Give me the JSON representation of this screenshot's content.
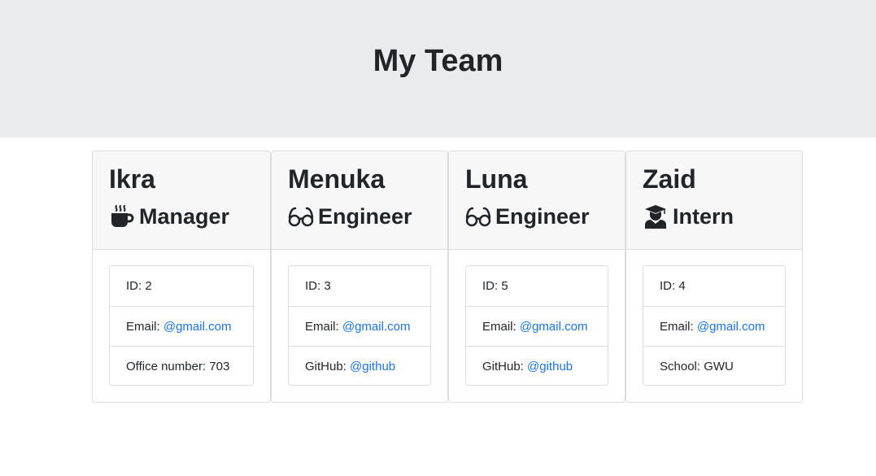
{
  "header": {
    "title": "My Team"
  },
  "team": [
    {
      "name": "Ikra",
      "role": "Manager",
      "role_icon": "coffee-mug-icon",
      "id_label": "ID:",
      "id": "2",
      "email_label": "Email:",
      "email": "@gmail.com",
      "extra_label": "Office number:",
      "extra_value": "703"
    },
    {
      "name": "Menuka",
      "role": "Engineer",
      "role_icon": "glasses-icon",
      "id_label": "ID:",
      "id": "3",
      "email_label": "Email:",
      "email": "@gmail.com",
      "extra_label": "GitHub:",
      "extra_value": "@github"
    },
    {
      "name": "Luna",
      "role": "Engineer",
      "role_icon": "glasses-icon",
      "id_label": "ID:",
      "id": "5",
      "email_label": "Email:",
      "email": "@gmail.com",
      "extra_label": "GitHub:",
      "extra_value": "@github"
    },
    {
      "name": "Zaid",
      "role": "Intern",
      "role_icon": "graduate-icon",
      "id_label": "ID:",
      "id": "4",
      "email_label": "Email:",
      "email": "@gmail.com",
      "extra_label": "School:",
      "extra_value": "GWU"
    }
  ],
  "colors": {
    "header_bg": "#e9ecef",
    "card_header_bg": "#f7f7f7",
    "link": "#1a73e8",
    "text": "#212529"
  }
}
